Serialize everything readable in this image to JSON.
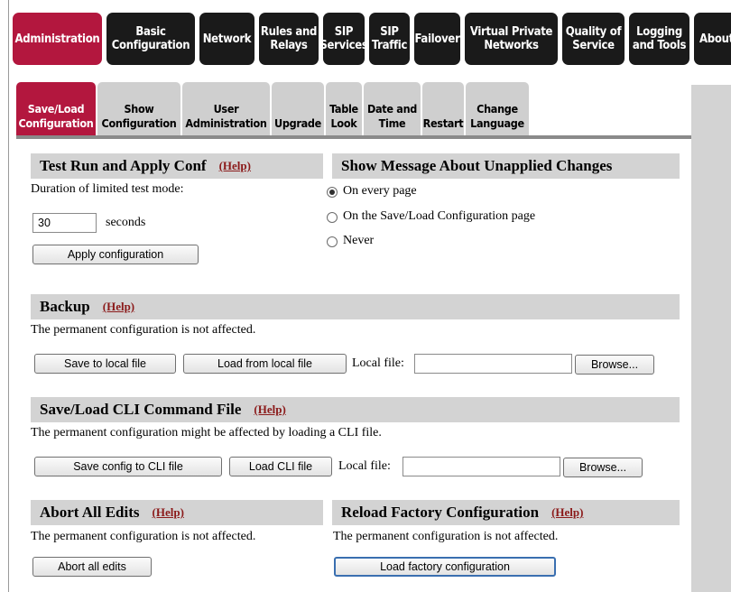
{
  "top_nav": {
    "tabs": [
      {
        "label": "Administration",
        "active": true
      },
      {
        "label": "Basic\nConfiguration"
      },
      {
        "label": "Network"
      },
      {
        "label": "Rules and\nRelays"
      },
      {
        "label": "SIP\nServices"
      },
      {
        "label": "SIP\nTraffic"
      },
      {
        "label": "Failover"
      },
      {
        "label": "Virtual Private\nNetworks"
      },
      {
        "label": "Quality of\nService"
      },
      {
        "label": "Logging\nand Tools"
      },
      {
        "label": "About"
      }
    ]
  },
  "sub_nav": {
    "tabs": [
      {
        "label": "Save/Load\nConfiguration",
        "active": true
      },
      {
        "label": "Show\nConfiguration"
      },
      {
        "label": "User\nAdministration"
      },
      {
        "label": "Upgrade"
      },
      {
        "label": "Table\nLook"
      },
      {
        "label": "Date and\nTime"
      },
      {
        "label": "Restart"
      },
      {
        "label": "Change\nLanguage"
      }
    ]
  },
  "test_run": {
    "title": "Test Run and Apply Conf",
    "help": "(Help)",
    "duration_label": "Duration of limited test mode:",
    "duration_value": "30",
    "seconds_label": "seconds",
    "apply_button": "Apply configuration"
  },
  "unapplied": {
    "title": "Show Message About Unapplied Changes",
    "options": [
      {
        "label": "On every page",
        "selected": true
      },
      {
        "label": "On the Save/Load Configuration page",
        "selected": false
      },
      {
        "label": "Never",
        "selected": false
      }
    ]
  },
  "backup": {
    "title": "Backup",
    "help": "(Help)",
    "note": "The permanent configuration is not affected.",
    "save_button": "Save to local file",
    "load_button": "Load from local file",
    "local_file_label": "Local file:",
    "local_file_value": "",
    "browse_button": "Browse..."
  },
  "cli": {
    "title": "Save/Load CLI Command File",
    "help": "(Help)",
    "note": "The permanent configuration might be affected by loading a CLI file.",
    "save_button": "Save config to CLI file",
    "load_button": "Load CLI file",
    "local_file_label": "Local file:",
    "local_file_value": "",
    "browse_button": "Browse..."
  },
  "abort": {
    "title": "Abort All Edits",
    "help": "(Help)",
    "note": "The permanent configuration is not affected.",
    "button": "Abort all edits"
  },
  "factory": {
    "title": "Reload Factory Configuration",
    "help": "(Help)",
    "note": "The permanent configuration is not affected.",
    "button": "Load factory configuration"
  }
}
